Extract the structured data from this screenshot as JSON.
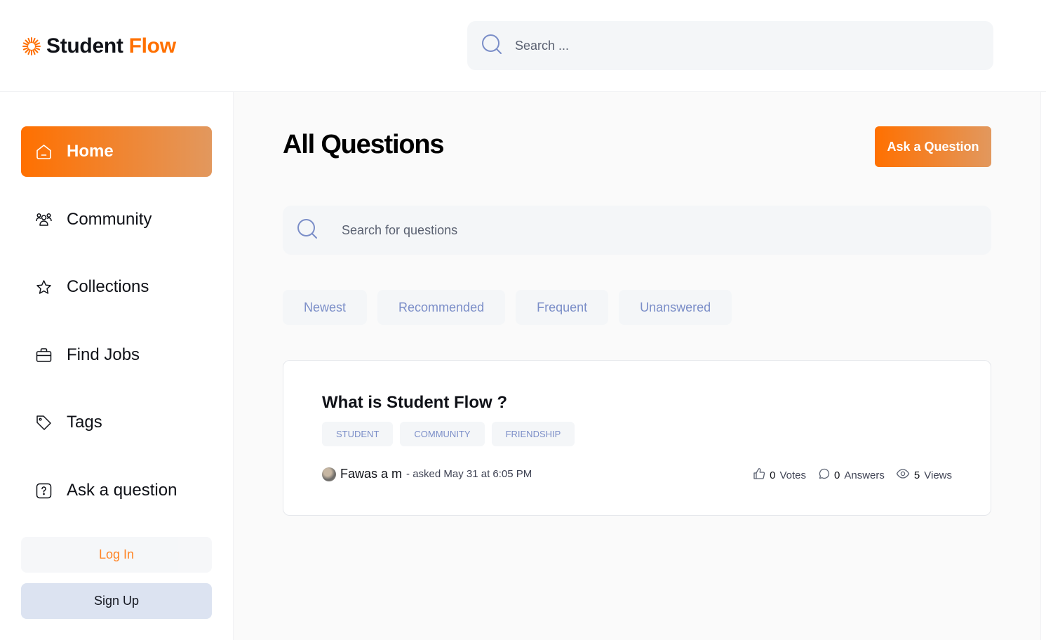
{
  "brand": {
    "word1": "Student",
    "word2": "Flow",
    "accent_color": "#ff7000"
  },
  "header": {
    "search_placeholder": "Search ..."
  },
  "sidebar": {
    "items": [
      {
        "label": "Home",
        "icon": "home-icon",
        "active": true
      },
      {
        "label": "Community",
        "icon": "users-icon",
        "active": false
      },
      {
        "label": "Collections",
        "icon": "star-icon",
        "active": false
      },
      {
        "label": "Find Jobs",
        "icon": "briefcase-icon",
        "active": false
      },
      {
        "label": "Tags",
        "icon": "tag-icon",
        "active": false
      },
      {
        "label": "Ask a question",
        "icon": "question-icon",
        "active": false
      }
    ],
    "login_label": "Log In",
    "signup_label": "Sign Up"
  },
  "main": {
    "title": "All Questions",
    "ask_button_label": "Ask a Question",
    "search_placeholder": "Search for questions",
    "filters": [
      "Newest",
      "Recommended",
      "Frequent",
      "Unanswered"
    ],
    "questions": [
      {
        "title": "What is Student Flow ?",
        "tags": [
          "student",
          "community",
          "friendship"
        ],
        "author": "Fawas a m",
        "meta": " - asked May 31 at 6:05 PM",
        "votes": "0",
        "votes_label": "Votes",
        "answers": "0",
        "answers_label": "Answers",
        "views": "5",
        "views_label": "Views"
      }
    ]
  }
}
